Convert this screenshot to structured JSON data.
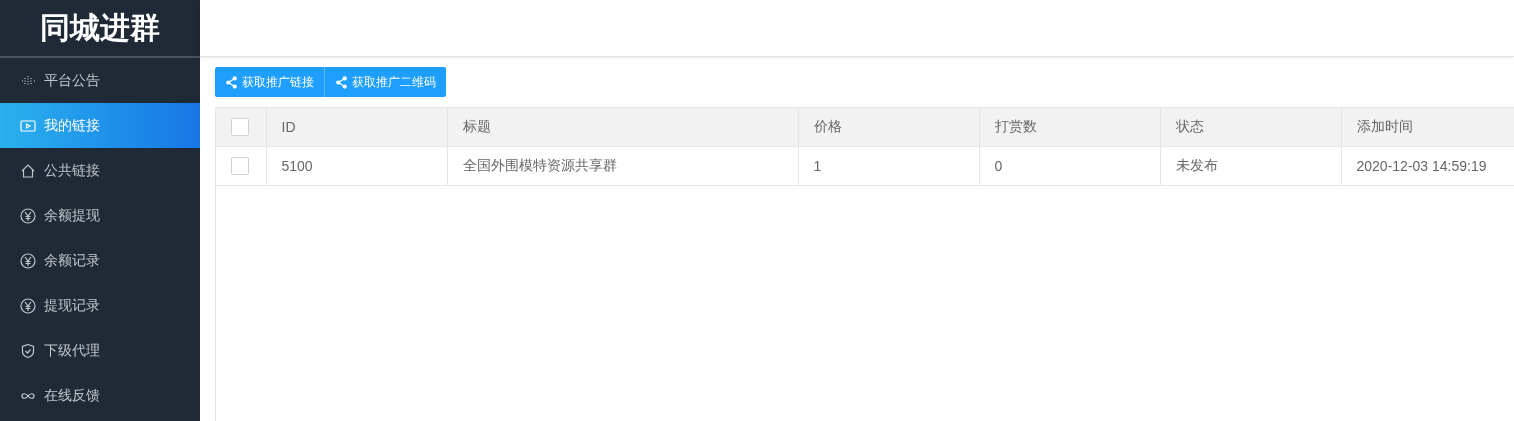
{
  "sidebar": {
    "logo": "同城进群",
    "items": [
      {
        "label": "平台公告",
        "selected": false
      },
      {
        "label": "我的链接",
        "selected": true
      },
      {
        "label": "公共链接",
        "selected": false
      },
      {
        "label": "余额提现",
        "selected": false
      },
      {
        "label": "余额记录",
        "selected": false
      },
      {
        "label": "提现记录",
        "selected": false
      },
      {
        "label": "下级代理",
        "selected": false
      },
      {
        "label": "在线反馈",
        "selected": false
      }
    ]
  },
  "toolbar": {
    "buttons": [
      "获取推广链接",
      "获取推广二维码"
    ]
  },
  "table": {
    "header_checked": false,
    "columns": [
      "ID",
      "标题",
      "价格",
      "打赏数",
      "状态",
      "添加时间"
    ],
    "rows": [
      {
        "checked": false,
        "cells": [
          "5100",
          "全国外围模特资源共享群",
          "1",
          "0",
          "未发布",
          "2020-12-03 14:59:19"
        ]
      }
    ]
  }
}
